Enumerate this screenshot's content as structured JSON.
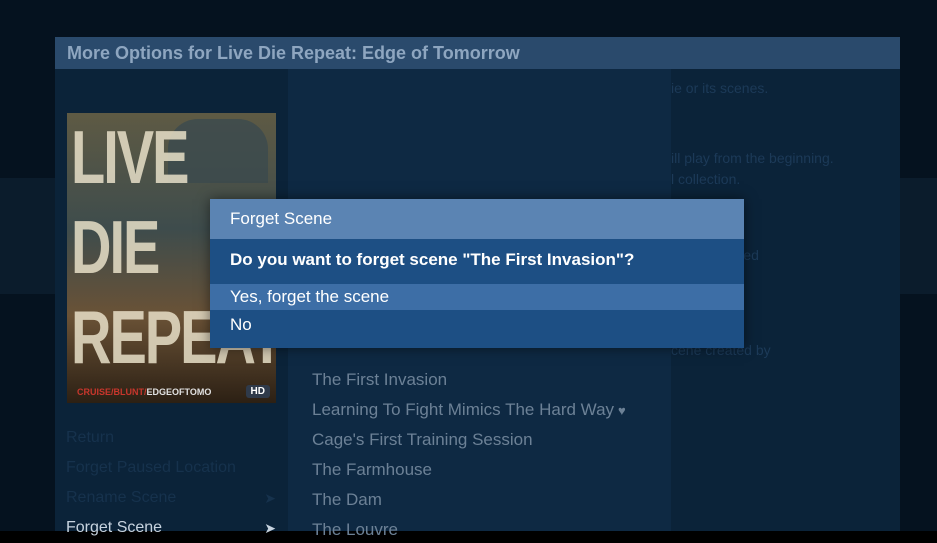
{
  "panel": {
    "title": "More Options for Live Die Repeat: Edge of Tomorrow"
  },
  "poster": {
    "words": [
      "LIVE",
      "DIE",
      "REPEAT"
    ],
    "credit_red": "CRUISE/BLUNT/",
    "credit_rest": "EDGEOFTOMO",
    "badge": "HD"
  },
  "menu": {
    "items": [
      {
        "label": "Return"
      },
      {
        "label": "Forget Paused Location"
      },
      {
        "label": "Rename Scene",
        "arrow": "➤"
      },
      {
        "label": "Forget Scene",
        "arrow": "➤"
      }
    ]
  },
  "scenes": {
    "items": [
      {
        "label": "The First Invasion"
      },
      {
        "label": "Learning To Fight Mimics The Hard Way",
        "heart": "♥"
      },
      {
        "label": "Cage's First Training Session"
      },
      {
        "label": "The Farmhouse"
      },
      {
        "label": "The Dam"
      },
      {
        "label": "The Louvre"
      }
    ]
  },
  "right_panel": {
    "lines": [
      "ie or its scenes.",
      "ill play from the beginning.",
      "l collection.",
      "cenes created",
      "cene created by"
    ]
  },
  "dialog": {
    "title": "Forget Scene",
    "question": "Do you want to forget scene \"The First Invasion\"?",
    "options": [
      {
        "label": "Yes, forget the scene",
        "selected": true
      },
      {
        "label": "No",
        "selected": false
      }
    ]
  }
}
